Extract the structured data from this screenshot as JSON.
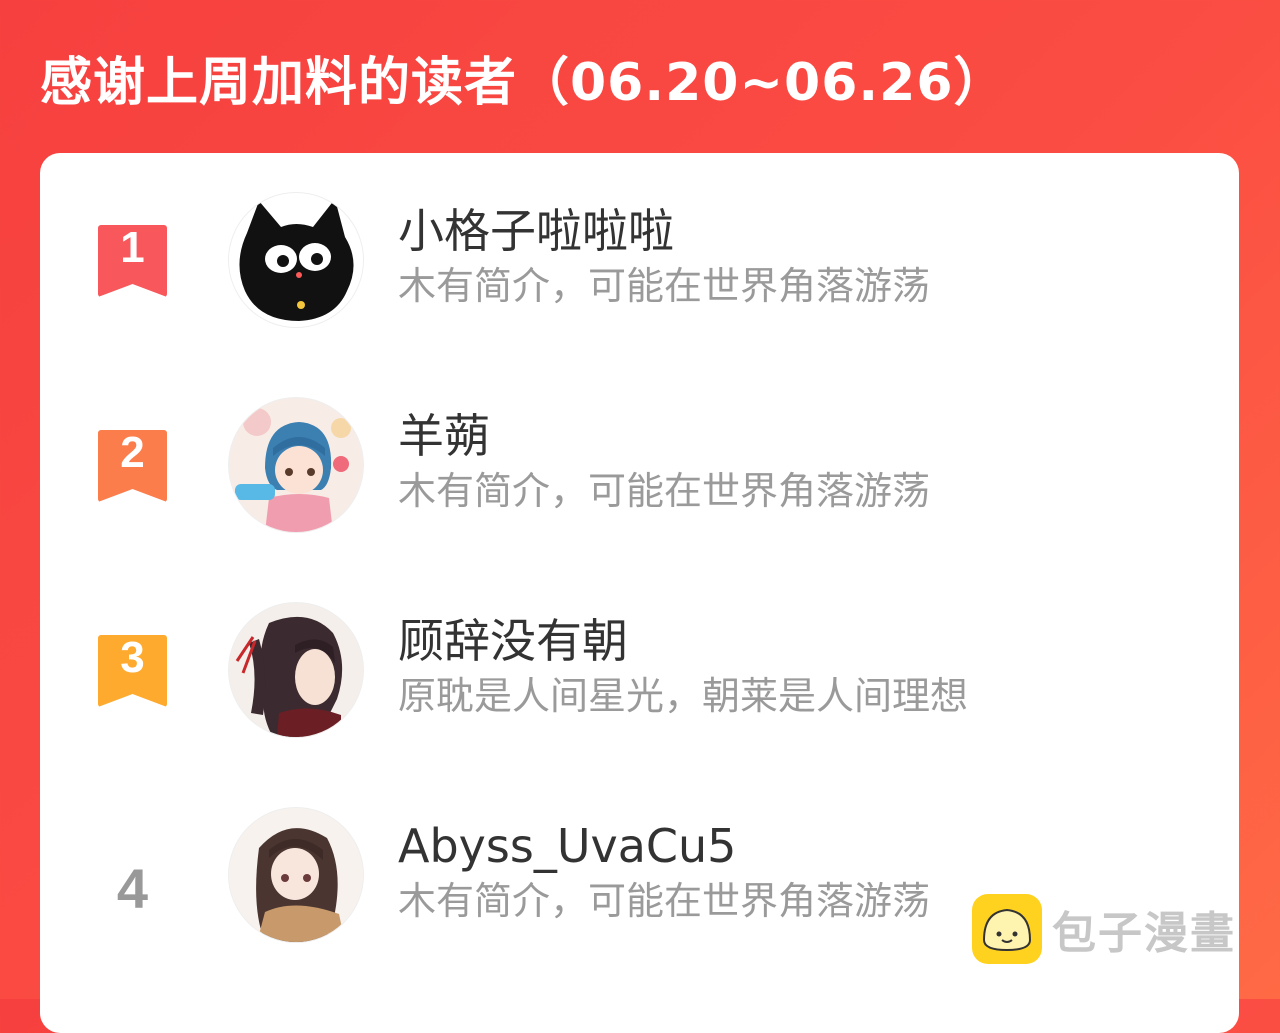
{
  "header": {
    "title": "感谢上周加料的读者（06.20~06.26）"
  },
  "readers": [
    {
      "rank": "1",
      "name": "小格子啦啦啦",
      "bio": "木有简介，可能在世界角落游荡",
      "rank_color": "#f8585b",
      "avatar": "black-cat-avatar"
    },
    {
      "rank": "2",
      "name": "羊蒴",
      "bio": "木有简介，可能在世界角落游荡",
      "rank_color": "#fb7d4c",
      "avatar": "anime-girl-blue-hair-avatar"
    },
    {
      "rank": "3",
      "name": "顾辞没有朝",
      "bio": "原耽是人间星光，朝莱是人间理想",
      "rank_color": "#fdaa2e",
      "avatar": "anime-boy-ponytail-avatar"
    },
    {
      "rank": "4",
      "name": "Abyss_UvaCu5",
      "bio": "木有简介，可能在世界角落游荡",
      "rank_color": "#999999",
      "avatar": "anime-girl-brown-hair-avatar"
    }
  ],
  "watermark": {
    "text": "包子漫畫",
    "logo_color": "#ffd21f"
  },
  "colors": {
    "background": "#f6403f",
    "card": "#ffffff",
    "name_text": "#333333",
    "bio_text": "#9a9a9a"
  }
}
